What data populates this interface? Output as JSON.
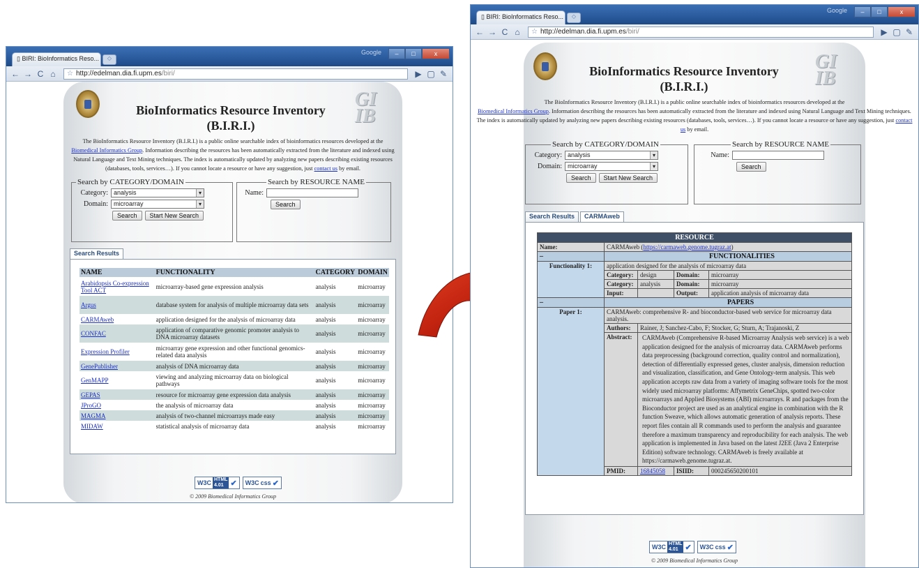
{
  "browser": {
    "tab_title": "BIRI: BioInformatics Reso...",
    "tab_close": "×",
    "url_host": "http://edelman.dia.fi.upm.es",
    "url_path": "/biri/",
    "google_label": "Google"
  },
  "page": {
    "title_line1": "BioInformatics Resource Inventory",
    "title_line2": "(B.I.R.I.)",
    "intro_1": "The BioInformatics Resource Inventory (B.I.R.I.) is a public online searchable index of bioinformatics resources developed at the",
    "intro_link_group": "Biomedical Informatics Group",
    "intro_2": ". Information describing the resources has been automatically extracted from the literature and indexed using Natural Language and Text Mining techniques. The index is automatically updated by analyzing new papers describing existing resources (databases, tools, services…). If you cannot locate a resource or have any suggestion, just",
    "intro_link_contact": "contact us",
    "intro_3": "by email."
  },
  "search_category": {
    "legend": "Search by CATEGORY/DOMAIN",
    "category_label": "Category:",
    "category_value": "analysis",
    "domain_label": "Domain:",
    "domain_value": "microarray",
    "search_button": "Search",
    "new_search_button": "Start New Search"
  },
  "search_name": {
    "legend": "Search by RESOURCE NAME",
    "name_label": "Name:",
    "search_button": "Search"
  },
  "tabs": {
    "results": "Search Results",
    "carmaweb": "CARMAweb"
  },
  "results": {
    "headers": [
      "NAME",
      "FUNCTIONALITY",
      "CATEGORY",
      "DOMAIN"
    ],
    "rows": [
      {
        "name": "Arabidopsis Co-expression Tool ACT",
        "func": "microarray-based gene expression analysis",
        "cat": "analysis",
        "dom": "microarray"
      },
      {
        "name": "Argus",
        "func": "database system for analysis of multiple microarray data sets",
        "cat": "analysis",
        "dom": "microarray"
      },
      {
        "name": "CARMAweb",
        "func": "application designed for the analysis of microarray data",
        "cat": "analysis",
        "dom": "microarray"
      },
      {
        "name": "CONFAC",
        "func": "application of comparative genomic promoter analysis to DNA microarray datasets",
        "cat": "analysis",
        "dom": "microarray"
      },
      {
        "name": "Expression Profiler",
        "func": "microarray gene expression and other functional genomics-related data analysis",
        "cat": "analysis",
        "dom": "microarray"
      },
      {
        "name": "GenePublisher",
        "func": "analysis of DNA microarray data",
        "cat": "analysis",
        "dom": "microarray"
      },
      {
        "name": "GenMAPP",
        "func": "viewing and analyzing microarray data on biological pathways",
        "cat": "analysis",
        "dom": "microarray"
      },
      {
        "name": "GEPAS",
        "func": "resource for microarray gene expression data analysis",
        "cat": "analysis",
        "dom": "microarray"
      },
      {
        "name": "JProGO",
        "func": "the analysis of microarray data",
        "cat": "analysis",
        "dom": "microarray"
      },
      {
        "name": "MAGMA",
        "func": "analysis of two-channel microarrays made easy",
        "cat": "analysis",
        "dom": "microarray"
      },
      {
        "name": "MIDAW",
        "func": "statistical analysis of microarray data",
        "cat": "analysis",
        "dom": "microarray"
      }
    ]
  },
  "resource": {
    "header": "RESOURCE",
    "name_label": "Name:",
    "name_value": "CARMAweb (",
    "name_link": "https://carmaweb.genome.tugraz.at",
    "name_close": ")",
    "functionalities_header": "FUNCTIONALITIES",
    "func_label": "Functionality 1:",
    "func_value": "application designed for the analysis of microarray data",
    "category_label": "Category:",
    "category_1": "design",
    "category_2": "analysis",
    "domain_label": "Domain:",
    "domain_1": "microarray",
    "domain_2": "microarray",
    "input_label": "Input:",
    "output_label": "Output:",
    "output_value": "application analysis of microarray data",
    "papers_header": "PAPERS",
    "paper_label": "Paper 1:",
    "paper_title": "CARMAweb: comprehensive R- and bioconductor-based web service for microarray data analysis.",
    "authors_label": "Authors:",
    "authors_value": "Rainer, J; Sanchez-Cabo, F; Stocker, G; Sturn, A; Trajanoski, Z",
    "abstract_label": "Abstract:",
    "abstract": "CARMAweb (Comprehensive R-based Microarray Analysis web service) is a web application designed for the analysis of microarray data. CARMAweb performs data preprocessing (background correction, quality control and normalization), detection of differentially expressed genes, cluster analysis, dimension reduction and visualization, classification, and Gene Ontology-term analysis. This web application accepts raw data from a variety of imaging software tools for the most widely used microarray platforms: Affymetrix GeneChips, spotted two-color microarrays and Applied Biosystems (ABI) microarrays. R and packages from the Bioconductor project are used as an analytical engine in combination with the R function Sweave, which allows automatic generation of analysis reports. These report files contain all R commands used to perform the analysis and guarantee therefore a maximum transparency and reproducibility for each analysis. The web application is implemented in Java based on the latest J2EE (Java 2 Enterprise Edition) software technology. CARMAweb is freely available at https://carmaweb.genome.tugraz.at.",
    "pmid_label": "PMID:",
    "pmid_value": "16845058",
    "isiid_label": "ISIID:",
    "isiid_value": "000245650200101"
  },
  "footer": {
    "w3c": "W3C",
    "html_badge_top": "HTML",
    "html_badge_bottom": "4.01",
    "css_badge": "css",
    "copyright": "© 2009 Biomedical Informatics Group"
  },
  "colors": {
    "arrow": "#d62a12",
    "titlebar": "#2a5a9c",
    "table_header": "#bccbd9",
    "row_alt": "#cfdcdc",
    "resource_header": "#3f4f66",
    "side_column": "#c4d8ec"
  }
}
